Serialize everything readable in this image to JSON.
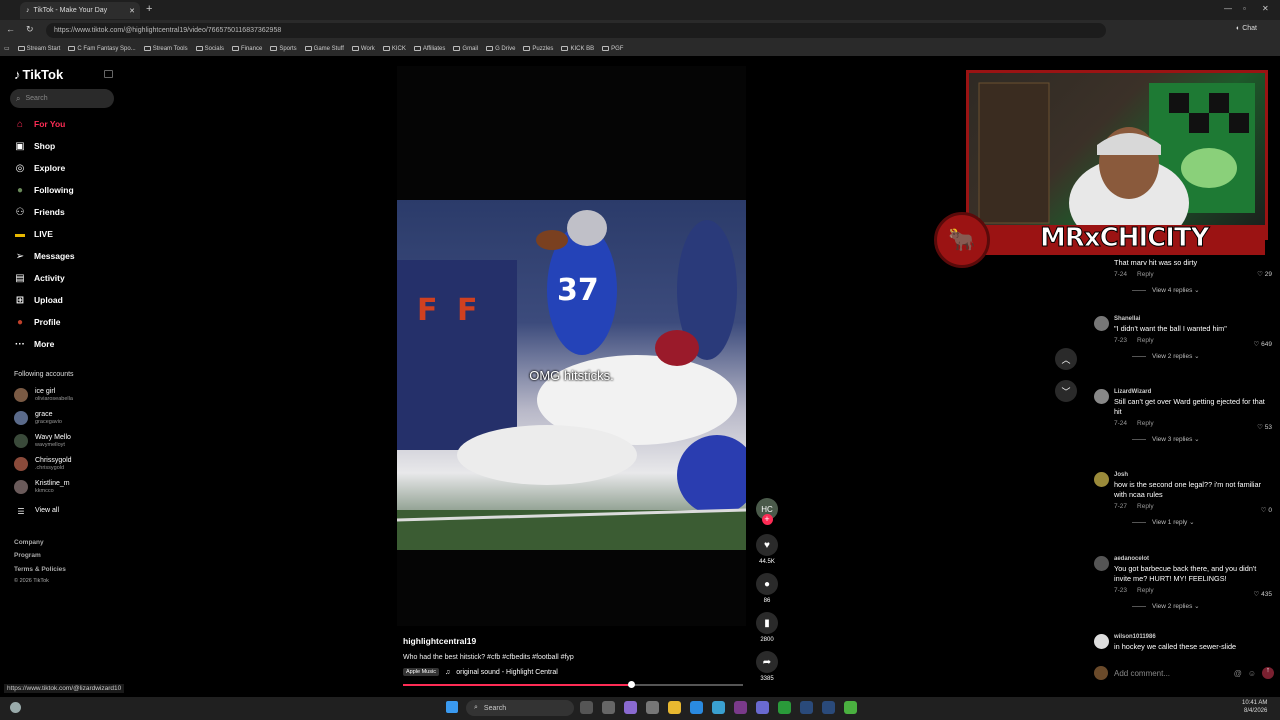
{
  "browser": {
    "tab_title": "TikTok - Make Your Day",
    "url": "https://www.tiktok.com/@highlightcentral19/video/7665750116837362958",
    "chat_label": "Chat",
    "bookmarks": [
      "Stream Start",
      "C Fam Fantasy Spo...",
      "Stream Tools",
      "Socials",
      "Finance",
      "Sports",
      "Game Stuff",
      "Work",
      "KICK",
      "Affiliates",
      "Gmail",
      "G Drive",
      "Puzzles",
      "KICK BB",
      "PGF"
    ],
    "status_url": "https://www.tiktok.com/@lizardwizard10"
  },
  "sidebar": {
    "logo": "TikTok",
    "search_placeholder": "Search",
    "nav": [
      {
        "label": "For You",
        "icon": "home-icon",
        "active": true
      },
      {
        "label": "Shop",
        "icon": "shop-icon"
      },
      {
        "label": "Explore",
        "icon": "compass-icon"
      },
      {
        "label": "Following",
        "icon": "following-icon"
      },
      {
        "label": "Friends",
        "icon": "friends-icon"
      },
      {
        "label": "LIVE",
        "icon": "live-icon"
      },
      {
        "label": "Messages",
        "icon": "messages-icon"
      },
      {
        "label": "Activity",
        "icon": "activity-icon"
      },
      {
        "label": "Upload",
        "icon": "upload-icon"
      },
      {
        "label": "Profile",
        "icon": "profile-icon"
      },
      {
        "label": "More",
        "icon": "more-icon"
      }
    ],
    "following_header": "Following accounts",
    "accounts": [
      {
        "name": "ice girl",
        "handle": "oliviaroseabella"
      },
      {
        "name": "grace",
        "handle": "gracegavio"
      },
      {
        "name": "Wavy Mello",
        "handle": "wavymelloyt"
      },
      {
        "name": "Chrissygold",
        "handle": ".chrissygold"
      },
      {
        "name": "Kristline_m",
        "handle": "kkmcco"
      }
    ],
    "view_all": "View all",
    "footer": [
      "Company",
      "Program",
      "Terms & Policies",
      "© 2026 TikTok"
    ]
  },
  "video": {
    "overlay_caption": "OMG hitsticks.",
    "author": "highlightcentral19",
    "description": "Who had the best hitstick? #cfb #cfbedits #football #fyp",
    "music_badge": "Apple Music",
    "sound": "original sound - Highlight Central",
    "progress": 0.67,
    "likes": "44.5K",
    "comments": "86",
    "saves": "2800",
    "shares": "3385"
  },
  "stream_overlay": {
    "name": "MRxCHICITY"
  },
  "comments": [
    {
      "user": "",
      "text": "That marv hit was so dirty",
      "date": "7-24",
      "reply": "Reply",
      "likes": "29",
      "view_replies": "View 4 replies"
    },
    {
      "user": "Shanellai",
      "text": "\"I didn't want the ball I wanted him\"",
      "date": "7-23",
      "reply": "Reply",
      "likes": "649",
      "view_replies": "View 2 replies"
    },
    {
      "user": "LizardWizard",
      "text": "Still can't get over Ward getting ejected for that hit",
      "date": "7-24",
      "reply": "Reply",
      "likes": "53",
      "view_replies": "View 3 replies"
    },
    {
      "user": "Josh",
      "text": "how is the second one legal?? i'm not familiar with ncaa rules",
      "date": "7-27",
      "reply": "Reply",
      "likes": "0",
      "view_replies": "View 1 reply"
    },
    {
      "user": "aedanocelot",
      "text": "You got barbecue back there, and you didn't invite me? HURT! MY! FEELINGS!",
      "date": "7-23",
      "reply": "Reply",
      "likes": "435",
      "view_replies": "View 2 replies"
    },
    {
      "user": "wilson1011986",
      "text": "in hockey we called these sewer-slide",
      "date": "",
      "reply": "",
      "likes": "",
      "view_replies": ""
    }
  ],
  "add_comment_placeholder": "Add comment...",
  "taskbar": {
    "search": "Search",
    "time": "10:41 AM",
    "date": "8/4/2026"
  }
}
